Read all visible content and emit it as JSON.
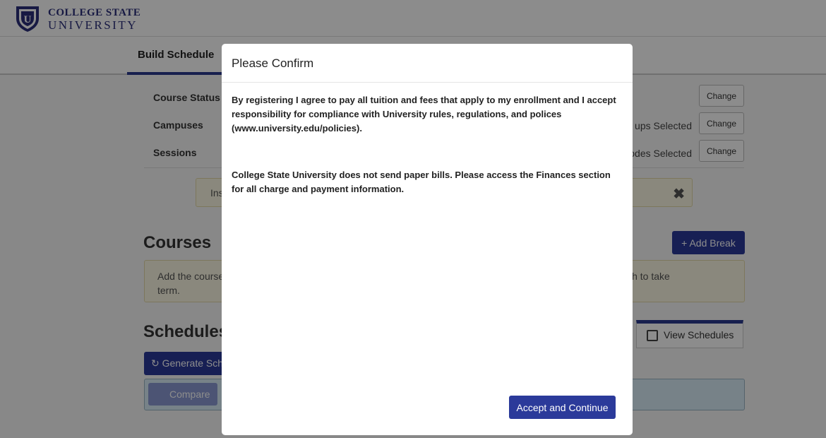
{
  "brand": {
    "line1": "COLLEGE STATE",
    "line2": "UNIVERSITY",
    "logo_letter": "U",
    "color": "#2b2f7a"
  },
  "tabs": {
    "build_schedule": "Build Schedule"
  },
  "filters": [
    {
      "label": "Course Status",
      "value": "",
      "button": "Change"
    },
    {
      "label": "Campuses",
      "value": "ups Selected",
      "button": "Change"
    },
    {
      "label": "Sessions",
      "value": "odes Selected",
      "button": "Change"
    }
  ],
  "alert": {
    "text": "Ins",
    "close": "✖"
  },
  "courses": {
    "heading": "Courses",
    "add_break": "+ Add Break",
    "note_left": "Add the course",
    "note_right": "ish to take",
    "note_line2": "term."
  },
  "schedules": {
    "heading": "Schedules",
    "generate": "↻ Generate Sch",
    "view_schedules": "View Schedules",
    "compare": "Compare"
  },
  "modal": {
    "title": "Please Confirm",
    "para1": "By registering I agree to pay all tuition and fees that apply to my enrollment and I accept responsibility for compliance with University rules, regulations, and polices (www.university.edu/policies).",
    "para2": "College State University does not send paper bills. Please access the Finances section for all charge and payment information.",
    "accept_button": "Accept and Continue"
  },
  "colors": {
    "primary": "#2b3a9a",
    "alert_bg": "#fcf8e3",
    "info_bg": "#d9edf7"
  }
}
